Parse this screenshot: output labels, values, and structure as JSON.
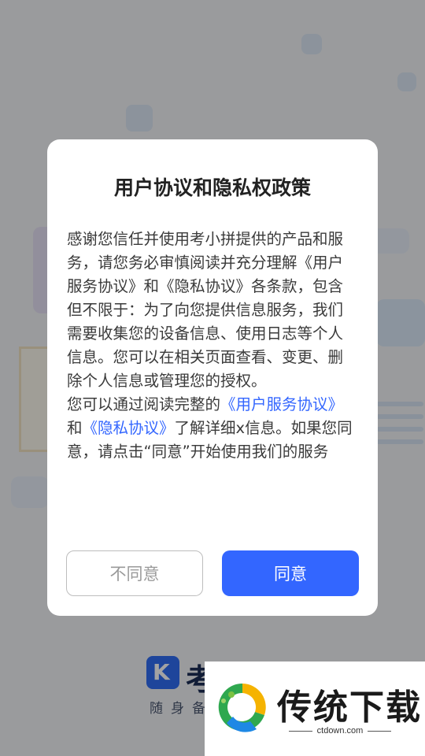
{
  "dialog": {
    "title": "用户协议和隐私权政策",
    "para1": "感谢您信任并使用考小拼提供的产品和服务，请您务必审慎阅读并充分理解《用户服务协议》和《隐私协议》各条款，包含但不限于：为了向您提供信息服务，我们需要收集您的设备信息、使用日志等个人信息。您可以在相关页面查看、变更、删除个人信息或管理您的授权。",
    "para2_prefix": "您可以通过阅读完整的",
    "link_user_agreement": "《用户服务协议》",
    "para2_and": "和",
    "link_privacy": "《隐私协议》",
    "para2_suffix": "了解详细x信息。如果您同意，请点击“同意”开始使用我们的服务",
    "decline_label": "不同意",
    "agree_label": "同意"
  },
  "background": {
    "brand_name": "考小拼",
    "brand_slogan": "随身备考",
    "logo_glyph": "K"
  },
  "watermark": {
    "title": "传统下载",
    "url": "ctdown.com"
  },
  "colors": {
    "accent": "#3366ff",
    "overlay": "rgba(0,0,0,0.36)",
    "dialog_bg": "#ffffff"
  }
}
